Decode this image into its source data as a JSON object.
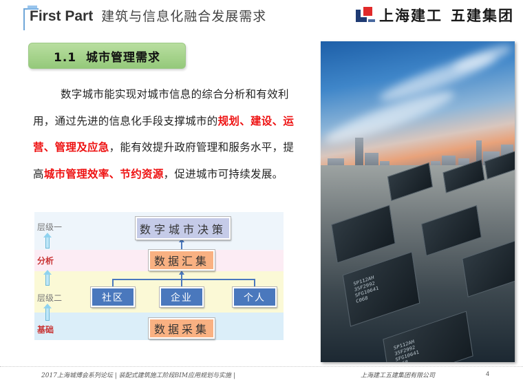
{
  "header": {
    "part_label": "First Part",
    "title": "建筑与信息化融合发展需求",
    "logo": {
      "icon": "scg-logo-icon",
      "company": "上海建工",
      "division": "五建集团",
      "colors": {
        "red": "#e12a2a",
        "navy": "#1f3b73"
      }
    }
  },
  "section": {
    "label": "1.1  城市管理需求",
    "badge_color": "#a6d48c"
  },
  "paragraph": {
    "lines": [
      [
        {
          "text": "数字城市能实现对城市信息的综合分析和有效利",
          "hl": false
        }
      ],
      [
        {
          "text": "用，通过先进的信息化手段支撑城市的",
          "hl": false
        },
        {
          "text": "规划、建设、运",
          "hl": true
        }
      ],
      [
        {
          "text": "营、管理及应急",
          "hl": true
        },
        {
          "text": "，能有效提升政府管理和服务水平，提",
          "hl": false
        }
      ],
      [
        {
          "text": "高",
          "hl": false
        },
        {
          "text": "城市管理效率、节约资源",
          "hl": true
        },
        {
          "text": "，促进城市可持续发展。",
          "hl": false
        }
      ]
    ],
    "highlight_color": "#ee1111"
  },
  "diagram": {
    "levels": {
      "level1": "层级一",
      "analysis": "分析",
      "level2": "层级二",
      "base": "基础"
    },
    "boxes": {
      "decision": "数字城市决策",
      "gather": "数据汇集",
      "collect": "数据采集",
      "sources": [
        "社区",
        "企业",
        "个人"
      ]
    }
  },
  "photo": {
    "description": "city skyline merging into circuit board",
    "chip_label": "SP112AH\n35F2992\nSFG10641\nC068"
  },
  "footer": {
    "left": "2017上海城博会系列论坛 | 装配式建筑施工阶段BIM应用规划与实施 |",
    "right": "上海建工五建集团有限公司",
    "page": "4"
  }
}
